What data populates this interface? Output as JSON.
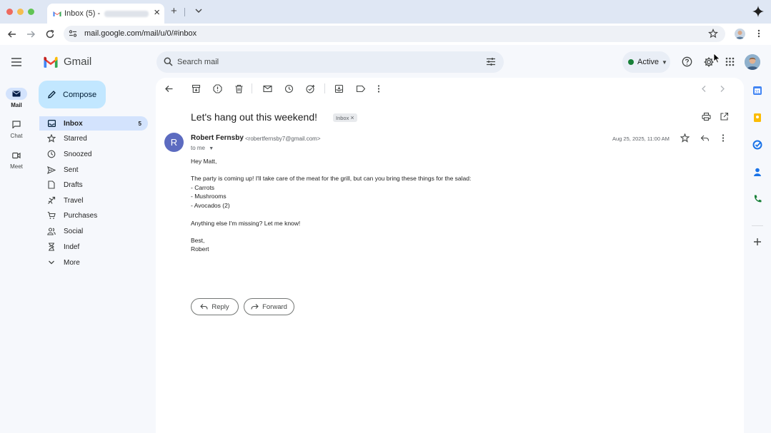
{
  "browser": {
    "tab_title": "Inbox (5) -",
    "new_tab": "+",
    "url": "mail.google.com/mail/u/0/#inbox"
  },
  "app": {
    "brand": "Gmail",
    "search_placeholder": "Search mail",
    "status": "Active"
  },
  "rail": [
    {
      "label": "Mail",
      "icon": "mail-icon"
    },
    {
      "label": "Chat",
      "icon": "chat-icon"
    },
    {
      "label": "Meet",
      "icon": "meet-icon"
    }
  ],
  "sidebar": {
    "compose": "Compose",
    "items": [
      {
        "label": "Inbox",
        "count": "5",
        "icon": "inbox-icon"
      },
      {
        "label": "Starred",
        "icon": "star-icon"
      },
      {
        "label": "Snoozed",
        "icon": "clock-icon"
      },
      {
        "label": "Sent",
        "icon": "send-icon"
      },
      {
        "label": "Drafts",
        "icon": "draft-icon"
      },
      {
        "label": "Travel",
        "icon": "plane-icon"
      },
      {
        "label": "Purchases",
        "icon": "cart-icon"
      },
      {
        "label": "Social",
        "icon": "people-icon"
      },
      {
        "label": "Indef",
        "icon": "hourglass-icon"
      },
      {
        "label": "More",
        "icon": "chevron-down-icon"
      }
    ]
  },
  "email": {
    "subject": "Let's hang out this weekend!",
    "label": "Inbox",
    "label_close": "×",
    "sender_initial": "R",
    "sender_name": "Robert Fernsby",
    "sender_email": "<robertfernsby7@gmail.com>",
    "recipient": "to me",
    "date": "Aug 25, 2025, 11:00 AM",
    "body": [
      "Hey Matt,",
      "The party is coming up! I'll take care of the meat for the grill, but can you bring these things for the salad:",
      "- Carrots",
      "- Mushrooms",
      "- Avocados (2)",
      "Anything else I'm missing? Let me know!",
      "Best,",
      "Robert"
    ],
    "reply": "Reply",
    "forward": "Forward"
  },
  "colors": {
    "accent": "#0b57d0",
    "compose_bg": "#c2e7ff",
    "selected_bg": "#d3e3fd",
    "active_dot": "#188038",
    "avatar": "#5c6bc0"
  }
}
